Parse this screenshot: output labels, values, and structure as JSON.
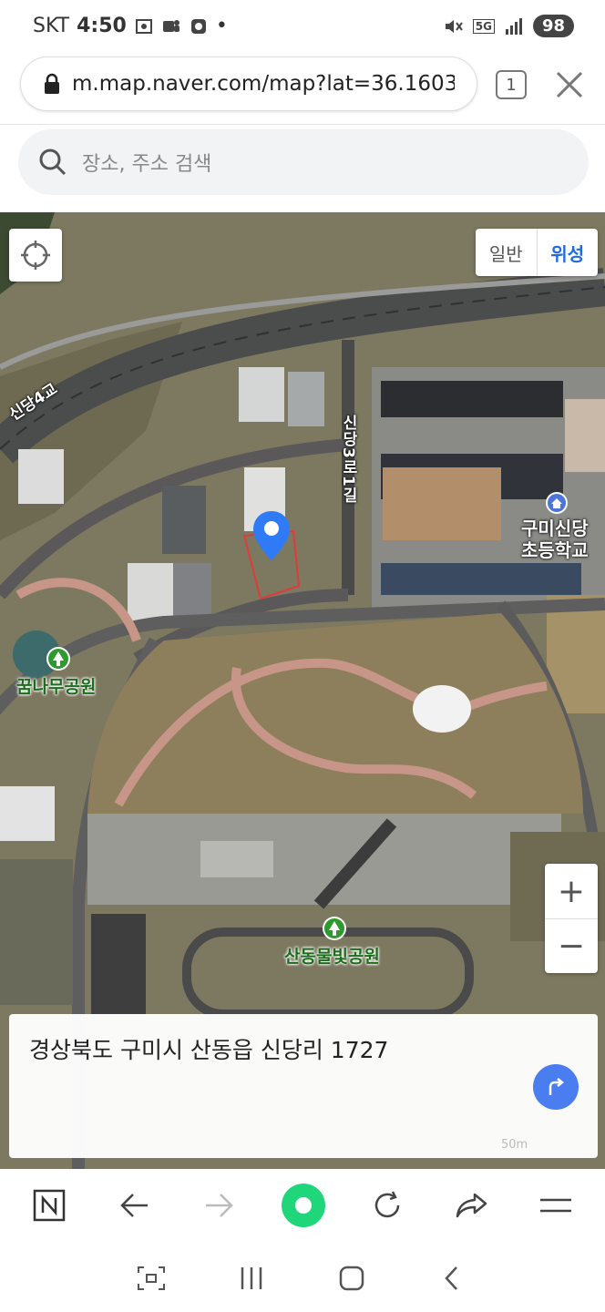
{
  "status_bar": {
    "carrier": "SKT",
    "time": "4:50",
    "dot": "•",
    "network": "5G",
    "battery": "98"
  },
  "browser": {
    "url": "m.map.naver.com/map?lat=36.16036...",
    "tab_count": "1"
  },
  "search": {
    "placeholder": "장소, 주소 검색"
  },
  "map": {
    "layer_normal": "일반",
    "layer_satellite": "위성",
    "active_layer": "위성",
    "labels": {
      "road_a": "신당4교",
      "road_b": "신당3로1길",
      "school_line1": "구미신당",
      "school_line2": "초등학교",
      "park_a": "꿈나무공원",
      "park_b": "산동물빛공원"
    },
    "zoom_in": "+",
    "zoom_out": "−"
  },
  "address_card": {
    "address": "경상북도 구미시 산동읍 신당리 1727",
    "scale": "50m"
  },
  "colors": {
    "accent": "#1f6be0",
    "marker": "#2f7bf5",
    "route_button": "#4a7df0",
    "toolbar_green": "#1fd67a"
  },
  "icons": [
    "lock-icon",
    "close-icon",
    "search-icon",
    "locate-icon",
    "school-pin-icon",
    "park-pin-icon",
    "route-icon",
    "naver-icon",
    "back-icon",
    "forward-icon",
    "home-icon",
    "refresh-icon",
    "share-icon",
    "menu-icon"
  ]
}
